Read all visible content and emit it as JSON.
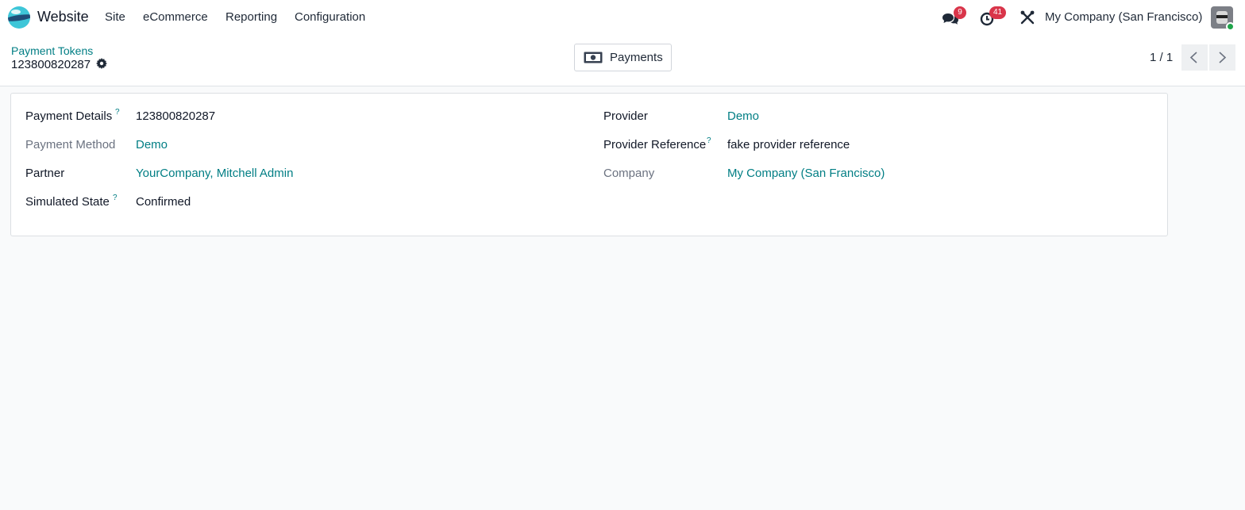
{
  "navbar": {
    "app_name": "Website",
    "menus": [
      "Site",
      "eCommerce",
      "Reporting",
      "Configuration"
    ],
    "messages_badge": "9",
    "activities_badge": "41",
    "company": "My Company (San Francisco)",
    "icons": [
      "website-logo-icon",
      "chat-icon",
      "clock-icon",
      "debug-tools-icon",
      "user-avatar"
    ]
  },
  "control": {
    "breadcrumb": "Payment Tokens",
    "record_name": "123800820287",
    "smart_button": "Payments",
    "pager": "1 / 1"
  },
  "form": {
    "left": [
      {
        "label": "Payment Details",
        "value": "123800820287",
        "help": "?"
      },
      {
        "label": "Payment Method",
        "value": "Demo"
      },
      {
        "label": "Partner",
        "value": "YourCompany, Mitchell Admin"
      },
      {
        "label": "Simulated State",
        "value": "Confirmed",
        "help": "?"
      }
    ],
    "right": [
      {
        "label": "Provider",
        "value": "Demo"
      },
      {
        "label": "Provider Reference",
        "value": "fake provider reference",
        "help": "?"
      },
      {
        "label": "Company",
        "value": "My Company (San Francisco)"
      }
    ]
  },
  "colors": {
    "accent": "#017e84",
    "badge": "#d9354a",
    "background": "#f9fafb"
  }
}
